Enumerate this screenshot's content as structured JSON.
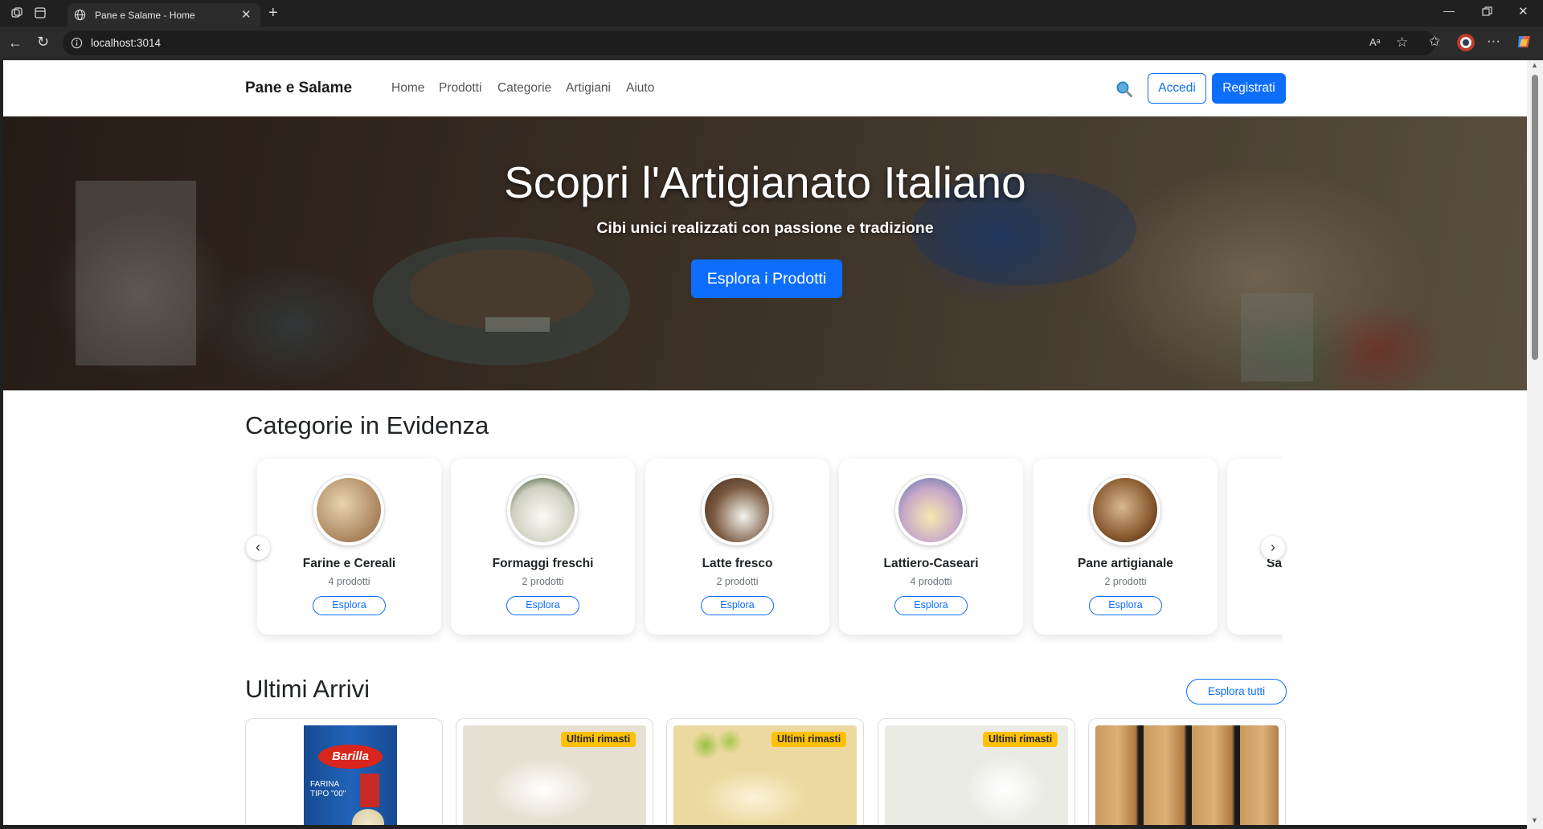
{
  "browser": {
    "tab_title": "Pane e Salame - Home",
    "url": "localhost:3014",
    "icons": [
      "workspaces-icon",
      "tab-actions-icon",
      "globe-icon",
      "close-icon",
      "new-tab-icon",
      "minimize-icon",
      "restore-icon",
      "window-close-icon",
      "back-icon",
      "refresh-icon",
      "site-info-icon",
      "read-aloud-icon",
      "favorite-icon",
      "favorites-icon",
      "profile-icon",
      "more-icon",
      "copilot-icon"
    ]
  },
  "navbar": {
    "brand": "Pane e Salame",
    "links": [
      "Home",
      "Prodotti",
      "Categorie",
      "Artigiani",
      "Aiuto"
    ],
    "login": "Accedi",
    "register": "Registrati",
    "search_icon": "search-icon"
  },
  "hero": {
    "title": "Scopri l'Artigianato Italiano",
    "subtitle": "Cibi unici realizzati con passione e tradizione",
    "cta": "Esplora i Prodotti"
  },
  "categories": {
    "title": "Categorie in Evidenza",
    "items": [
      {
        "name": "Farine e Cereali",
        "count": "4 prodotti",
        "button": "Esplora",
        "color": "#c8a27a"
      },
      {
        "name": "Formaggi freschi",
        "count": "2 prodotti",
        "button": "Esplora",
        "color": "#e8e6dc"
      },
      {
        "name": "Latte fresco",
        "count": "2 prodotti",
        "button": "Esplora",
        "color": "#7a5a40"
      },
      {
        "name": "Lattiero-Caseari",
        "count": "4 prodotti",
        "button": "Esplora",
        "color": "#9aa4c8"
      },
      {
        "name": "Pane artigianale",
        "count": "2 prodotti",
        "button": "Esplora",
        "color": "#a0734a"
      },
      {
        "name": "Sa",
        "count": "",
        "button": "",
        "color": "#ffffff"
      }
    ]
  },
  "latest": {
    "title": "Ultimi Arrivi",
    "explore_all": "Esplora tutti",
    "products": [
      {
        "badge": "",
        "image_text": "Barilla",
        "image_sub": "FARINA TIPO \"00\"",
        "color": "#1a4f9c"
      },
      {
        "badge": "Ultimi rimasti",
        "color": "#e9e2d4"
      },
      {
        "badge": "Ultimi rimasti",
        "color": "#e8d8a8"
      },
      {
        "badge": "Ultimi rimasti",
        "color": "#f2f2ef"
      },
      {
        "badge": "",
        "color": "#b08050"
      }
    ]
  }
}
